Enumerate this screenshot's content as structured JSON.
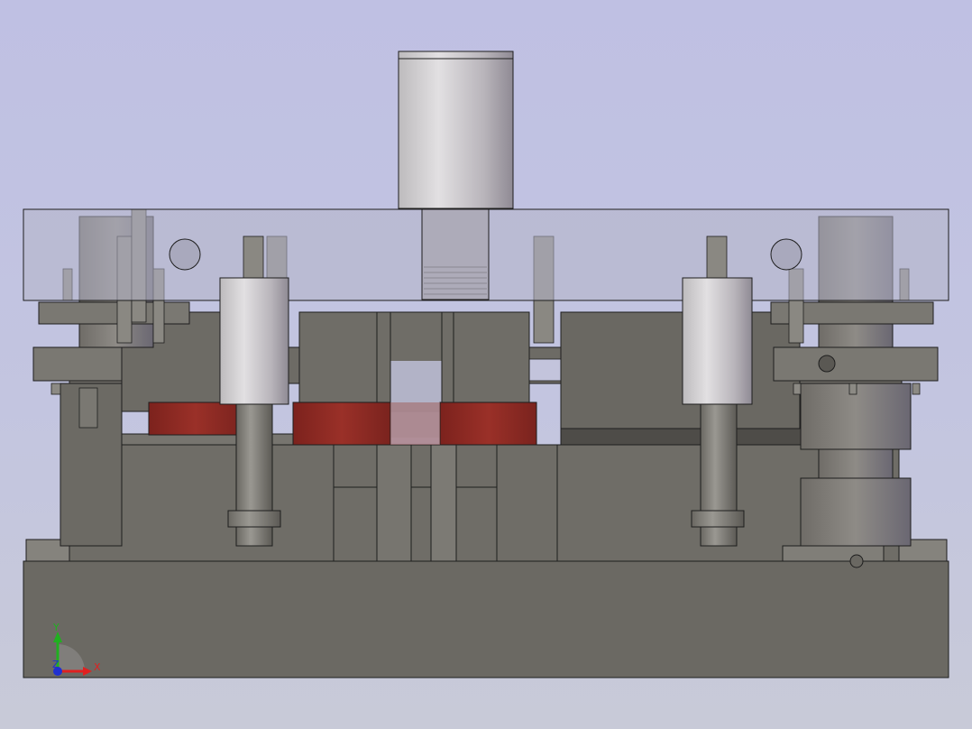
{
  "viewport": {
    "background_top": "#bfc0e3",
    "background_bottom": "#c8cad8"
  },
  "colors": {
    "steel_dark": "#6b6963",
    "steel_mid": "#7a7872",
    "steel_light": "#8c8a84",
    "edge": "#1e1e1e",
    "transparent_plate": "#b4b4c8",
    "cylinder_light": "#d8d6d8",
    "cylinder_shade": "#a09ca4",
    "red_block": "#8a2a24",
    "axis_x": "#e02020",
    "axis_y": "#20b020",
    "axis_z": "#2030d0"
  },
  "triad": {
    "x_label": "X",
    "y_label": "Y",
    "z_label": "Z",
    "x_icon": "x-axis-arrow-icon",
    "y_icon": "y-axis-arrow-icon",
    "z_icon": "z-axis-dot-icon"
  }
}
